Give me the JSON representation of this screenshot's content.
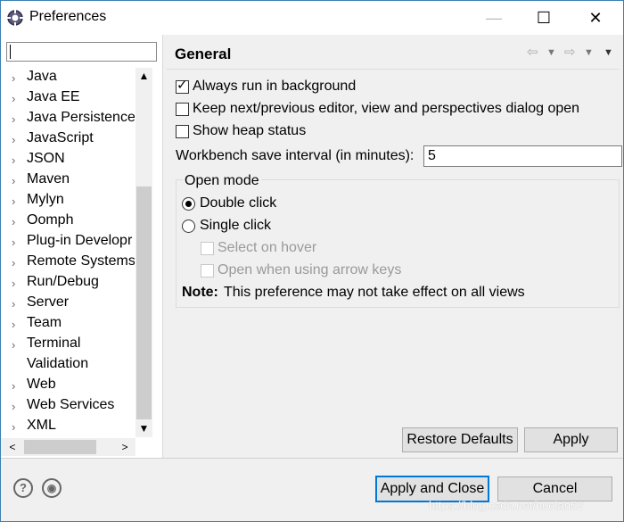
{
  "window": {
    "title": "Preferences",
    "minimize_glyph": "—",
    "maximize_glyph": "☐",
    "close_glyph": "✕",
    "app_icon": "eclipse-icon"
  },
  "sidebar": {
    "filter": {
      "value": "",
      "placeholder": ""
    },
    "items": [
      {
        "label": "Java",
        "expandable": true
      },
      {
        "label": "Java EE",
        "expandable": true
      },
      {
        "label": "Java Persistence",
        "expandable": true
      },
      {
        "label": "JavaScript",
        "expandable": true
      },
      {
        "label": "JSON",
        "expandable": true
      },
      {
        "label": "Maven",
        "expandable": true
      },
      {
        "label": "Mylyn",
        "expandable": true
      },
      {
        "label": "Oomph",
        "expandable": true
      },
      {
        "label": "Plug-in Developr",
        "expandable": true
      },
      {
        "label": "Remote Systems",
        "expandable": true
      },
      {
        "label": "Run/Debug",
        "expandable": true
      },
      {
        "label": "Server",
        "expandable": true
      },
      {
        "label": "Team",
        "expandable": true
      },
      {
        "label": "Terminal",
        "expandable": true
      },
      {
        "label": "Validation",
        "expandable": false
      },
      {
        "label": "Web",
        "expandable": true
      },
      {
        "label": "Web Services",
        "expandable": true
      },
      {
        "label": "XML",
        "expandable": true
      }
    ],
    "chevron_glyph": "›",
    "scroll_up_glyph": "▲",
    "scroll_down_glyph": "▼",
    "scroll_left_glyph": "<",
    "scroll_right_glyph": ">"
  },
  "main": {
    "title": "General",
    "nav": {
      "back_glyph": "⇦",
      "forward_glyph": "⇨",
      "dropdown_glyph": "▼",
      "menu_glyph": "▼"
    },
    "options": {
      "always_background": {
        "label": "Always run in background",
        "checked": true
      },
      "keep_dialog_open": {
        "label": "Keep next/previous editor, view and perspectives dialog open",
        "checked": false
      },
      "show_heap": {
        "label": "Show heap status",
        "checked": false
      }
    },
    "interval": {
      "label": "Workbench save interval (in minutes):",
      "value": "5"
    },
    "open_mode": {
      "group_label": "Open mode",
      "double_click": {
        "label": "Double click",
        "selected": true
      },
      "single_click": {
        "label": "Single click",
        "selected": false
      },
      "select_on_hover": {
        "label": "Select on hover",
        "checked": false,
        "enabled": false
      },
      "open_arrow_keys": {
        "label": "Open when using arrow keys",
        "checked": false,
        "enabled": false
      },
      "note_bold": "Note:",
      "note_text": "This preference may not take effect on all views"
    },
    "restore_defaults_label": "Restore Defaults",
    "apply_label": "Apply"
  },
  "footer": {
    "help_icon_glyph": "?",
    "import_icon_glyph": "◉",
    "apply_close_label": "Apply and Close",
    "cancel_label": "Cancel"
  },
  "watermark": "https://blog.csdn.net/huolan52",
  "colors": {
    "accent": "#0078d7",
    "window_border": "#3c7fb1"
  }
}
